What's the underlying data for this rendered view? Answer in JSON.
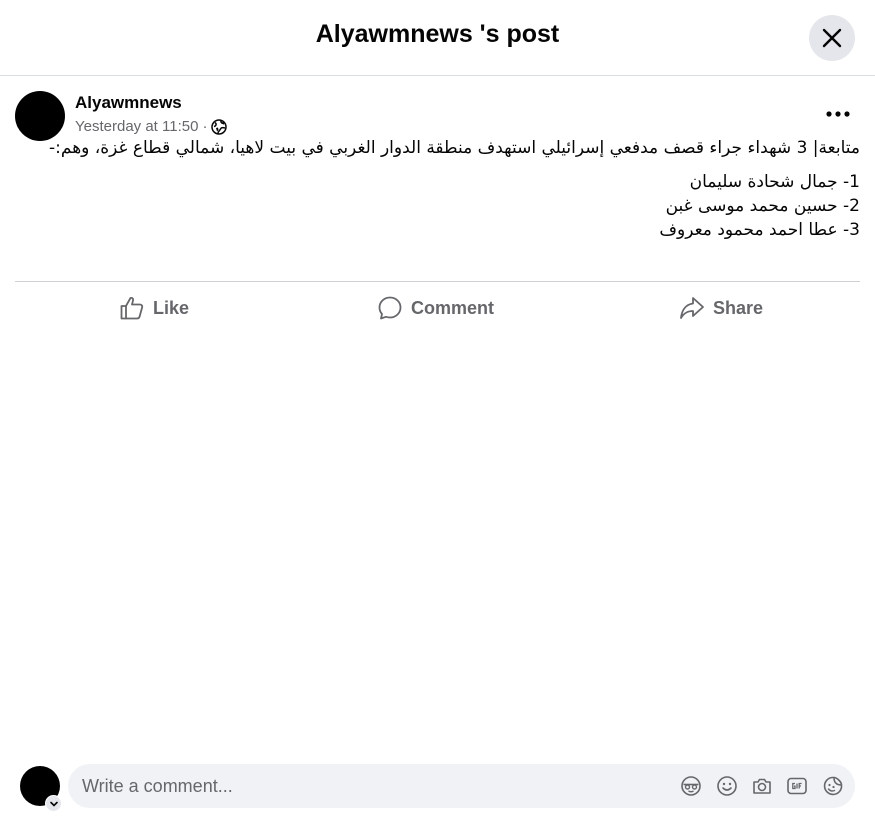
{
  "header": {
    "title": "Alyawmnews 's post"
  },
  "post": {
    "author": "Alyawmnews",
    "timestamp": "Yesterday at 11:50",
    "separator": "·",
    "privacy_icon": "globe-icon",
    "text": "متابعة| 3 شهداء جراء قصف مدفعي إسرائيلي استهدف منطقة الدوار الغربي في بيت لاهيا، شمالي قطاع غزة، وهم:-",
    "list": [
      "1-  جمال شحادة سليمان",
      "2- حسين محمد موسى غبن",
      "3- عطا احمد محمود معروف"
    ]
  },
  "actions": {
    "like": "Like",
    "comment": "Comment",
    "share": "Share"
  },
  "comment": {
    "placeholder": "Write a comment...",
    "icons": [
      "avatar-sticker-icon",
      "emoji-icon",
      "camera-icon",
      "gif-icon",
      "sticker-icon"
    ]
  },
  "colors": {
    "secondary_text": "#65676b",
    "divider": "#ced0d4",
    "input_bg": "#f0f2f5",
    "button_bg": "#e4e6eb"
  }
}
